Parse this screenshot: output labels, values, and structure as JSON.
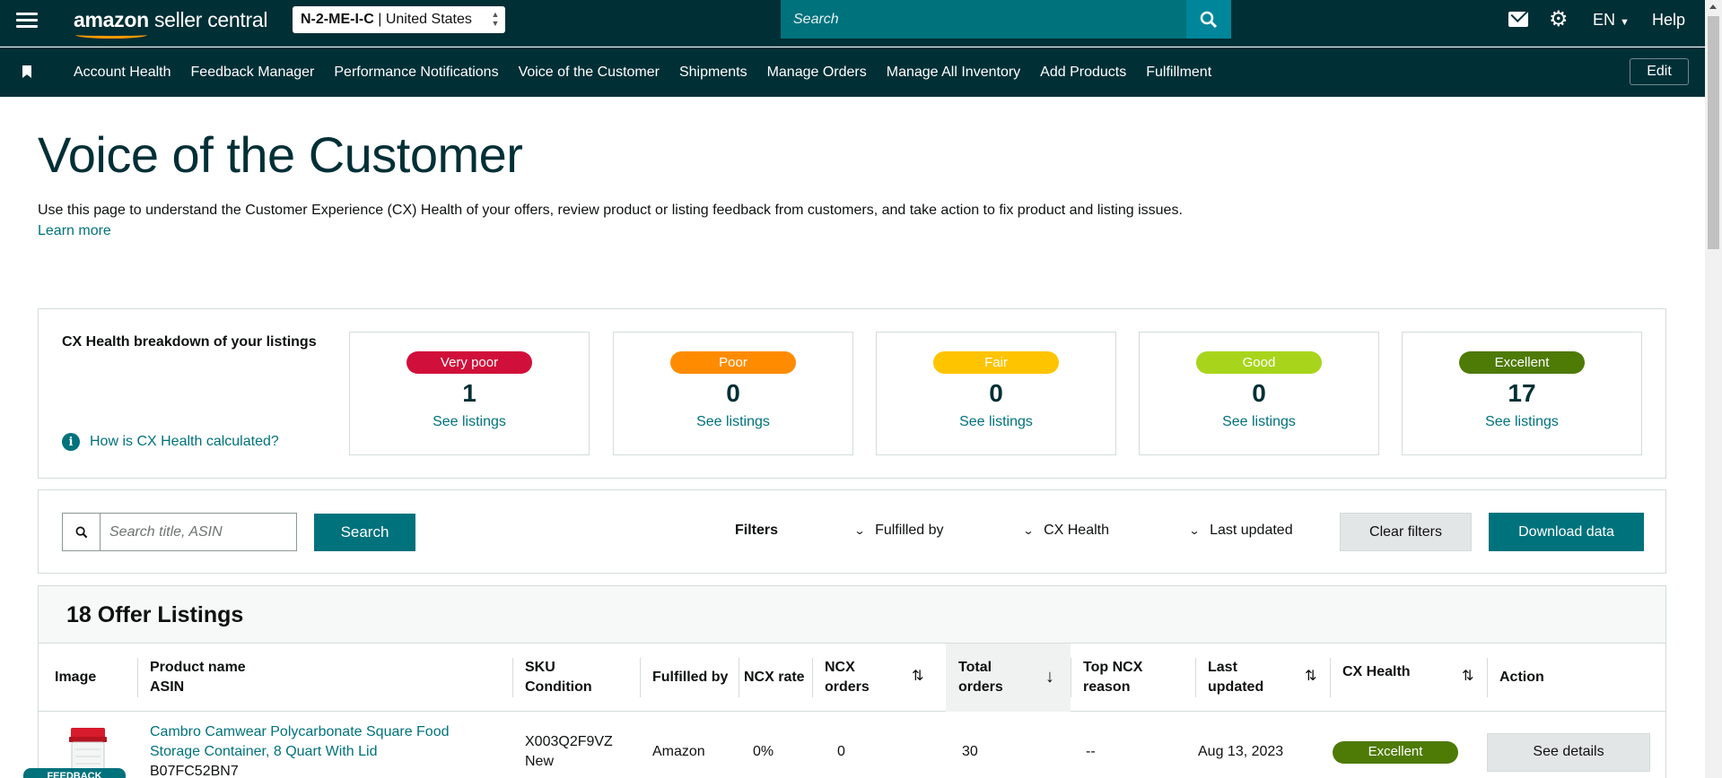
{
  "topbar": {
    "logo_left": "amazon",
    "logo_right": "seller central",
    "store_code": "N-2-ME-I-C",
    "store_country": "| United States",
    "search_placeholder": "Search",
    "language": "EN",
    "help": "Help"
  },
  "nav": {
    "items": [
      "Account Health",
      "Feedback Manager",
      "Performance Notifications",
      "Voice of the Customer",
      "Shipments",
      "Manage Orders",
      "Manage All Inventory",
      "Add Products",
      "Fulfillment"
    ],
    "edit": "Edit"
  },
  "page": {
    "title": "Voice of the Customer",
    "intro": "Use this page to understand the Customer Experience (CX) Health of your offers, review product or listing feedback from customers, and take action to fix product and listing issues.",
    "learn_more": "Learn more"
  },
  "cx_health": {
    "title": "CX Health breakdown of your listings",
    "how_link": "How is CX Health calculated?",
    "cards": [
      {
        "label": "Very poor",
        "count": "1",
        "link": "See listings",
        "color": "#d0103a"
      },
      {
        "label": "Poor",
        "count": "0",
        "link": "See listings",
        "color": "#ff8c00"
      },
      {
        "label": "Fair",
        "count": "0",
        "link": "See listings",
        "color": "#ffc400"
      },
      {
        "label": "Good",
        "count": "0",
        "link": "See listings",
        "color": "#a8d51c"
      },
      {
        "label": "Excellent",
        "count": "17",
        "link": "See listings",
        "color": "#4e7a06"
      }
    ]
  },
  "filters": {
    "search_placeholder": "Search title, ASIN",
    "search_button": "Search",
    "label": "Filters",
    "fulfilled_by": "Fulfilled by",
    "cx_health": "CX Health",
    "last_updated": "Last updated",
    "clear": "Clear filters",
    "download": "Download data"
  },
  "table": {
    "title": "18 Offer Listings",
    "headers": {
      "image": "Image",
      "product_name": "Product name",
      "asin": "ASIN",
      "sku": "SKU",
      "condition": "Condition",
      "fulfilled_by": "Fulfilled by",
      "ncx_rate": "NCX rate",
      "ncx_orders_1": "NCX",
      "ncx_orders_2": "orders",
      "total_orders_1": "Total",
      "total_orders_2": "orders",
      "top_ncx_1": "Top NCX",
      "top_ncx_2": "reason",
      "last_updated_1": "Last",
      "last_updated_2": "updated",
      "cx_health": "CX Health",
      "action": "Action"
    },
    "rows": [
      {
        "product_name_1": "Cambro Camwear Polycarbonate Square Food",
        "product_name_2": "Storage Container, 8 Quart With Lid",
        "asin": "B07FC52BN7",
        "sku": "X003Q2F9VZ",
        "condition": "New",
        "fulfilled_by": "Amazon",
        "ncx_rate": "0%",
        "ncx_orders": "0",
        "total_orders": "30",
        "top_ncx_reason": "--",
        "last_updated": "Aug 13, 2023",
        "cx_health": "Excellent",
        "action": "See details"
      }
    ]
  },
  "feedback_tab": "FEEDBACK"
}
